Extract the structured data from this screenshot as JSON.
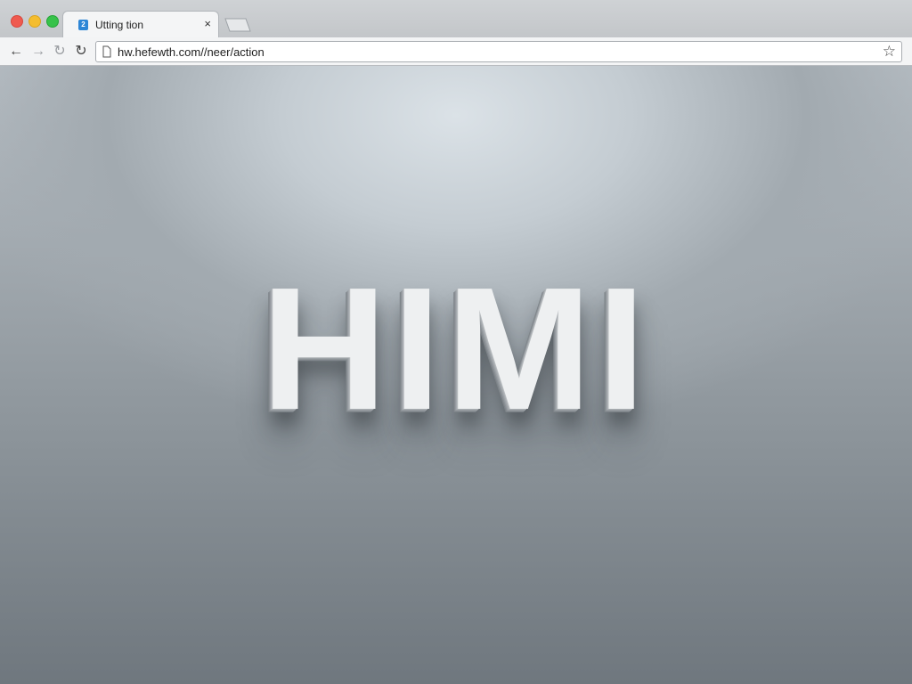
{
  "browser": {
    "tab": {
      "title": "Utting tion",
      "favicon_glyph": "2",
      "close_label": "×"
    },
    "toolbar": {
      "back_glyph": "←",
      "forward_glyph": "→",
      "reload_glyph": "↻",
      "reload2_glyph": "↻",
      "url": "hw.hefewth.com//neer/action",
      "bookmark_glyph": "☆"
    },
    "colors": {
      "close_dot": "#ef5a4f",
      "minimize_dot": "#f4bd2f",
      "maximize_dot": "#37c24a"
    }
  },
  "page": {
    "logo_text": "HIMI"
  }
}
